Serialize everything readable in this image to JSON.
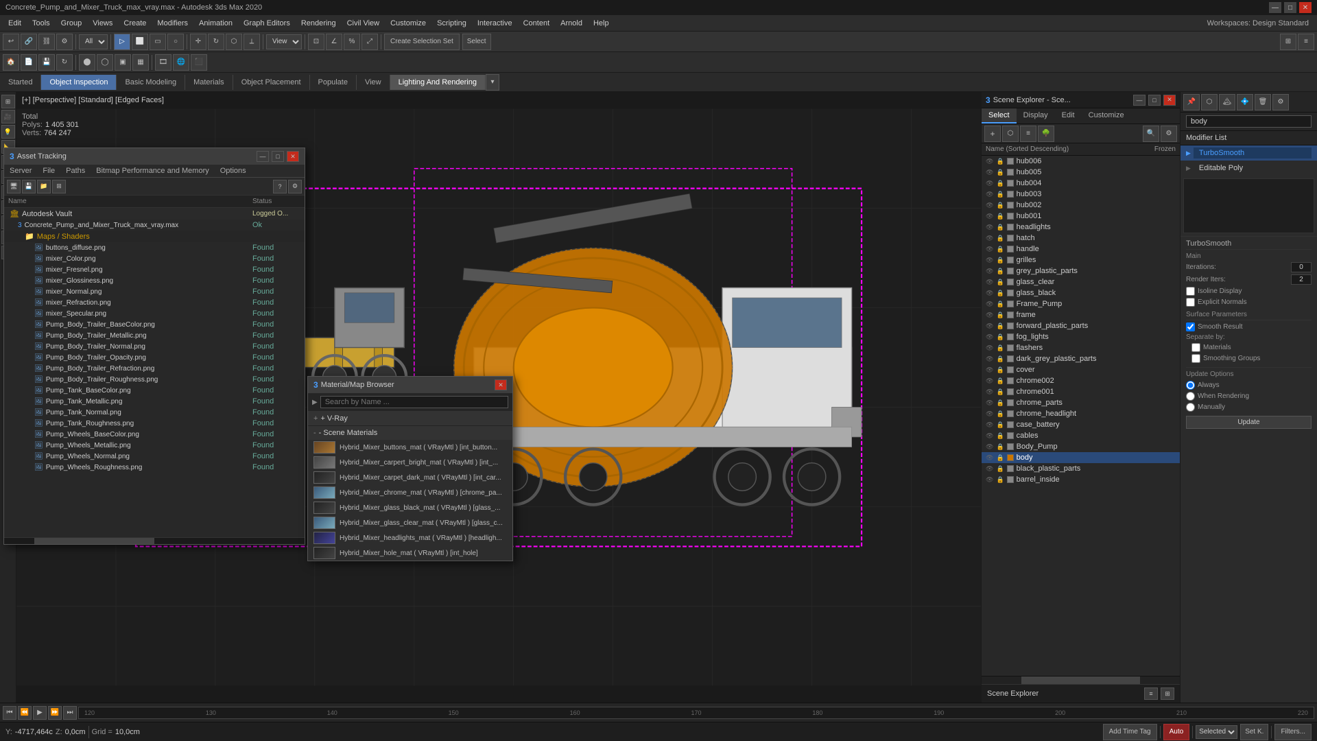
{
  "titlebar": {
    "title": "Concrete_Pump_and_Mixer_Truck_max_vray.max - Autodesk 3ds Max 2020",
    "min": "—",
    "max": "□",
    "close": "✕"
  },
  "menubar": {
    "items": [
      "Edit",
      "Tools",
      "Group",
      "Views",
      "Create",
      "Modifiers",
      "Animation",
      "Graph Editors",
      "Rendering",
      "Civil View",
      "Customize",
      "Scripting",
      "Interactive",
      "Content",
      "Arnold",
      "Help"
    ]
  },
  "toolbar": {
    "select_all_label": "All",
    "view_label": "View"
  },
  "tabs": {
    "items": [
      "Started",
      "Object Inspection",
      "Basic Modeling",
      "Materials",
      "Object Placement",
      "Populate",
      "View",
      "Lighting And Rendering"
    ]
  },
  "viewport": {
    "label": "[+] [Perspective] [Standard] [Edged Faces]",
    "stats": {
      "total_label": "Total",
      "polys_label": "Polys:",
      "polys_value": "1 405 301",
      "verts_label": "Verts:",
      "verts_value": "764 247"
    }
  },
  "scene_explorer": {
    "title": "Scene Explorer - Sce...",
    "tabs": [
      "Select",
      "Display",
      "Edit",
      "Customize"
    ],
    "header_name": "Name (Sorted Descending)",
    "header_frozen": "Frozen",
    "items": [
      {
        "name": "hub006"
      },
      {
        "name": "hub005"
      },
      {
        "name": "hub004"
      },
      {
        "name": "hub003"
      },
      {
        "name": "hub002"
      },
      {
        "name": "hub001"
      },
      {
        "name": "headlights"
      },
      {
        "name": "hatch"
      },
      {
        "name": "handle"
      },
      {
        "name": "grilles"
      },
      {
        "name": "grey_plastic_parts"
      },
      {
        "name": "glass_clear"
      },
      {
        "name": "glass_black"
      },
      {
        "name": "Frame_Pump"
      },
      {
        "name": "frame"
      },
      {
        "name": "forward_plastic_parts"
      },
      {
        "name": "fog_lights"
      },
      {
        "name": "flashers"
      },
      {
        "name": "dark_grey_plastic_parts"
      },
      {
        "name": "cover"
      },
      {
        "name": "chrome002"
      },
      {
        "name": "chrome001"
      },
      {
        "name": "chrome_parts"
      },
      {
        "name": "chrome_headlight"
      },
      {
        "name": "case_battery"
      },
      {
        "name": "cables"
      },
      {
        "name": "Body_Pump"
      },
      {
        "name": "body",
        "selected": true
      },
      {
        "name": "black_plastic_parts"
      },
      {
        "name": "barrel_inside"
      }
    ]
  },
  "properties_panel": {
    "modifier_list_label": "Modifier List",
    "body_label": "body",
    "modifiers": [
      {
        "name": "TurboSmooth",
        "type": "active"
      },
      {
        "name": "Editable Poly",
        "type": "sub"
      }
    ],
    "turbosmooth": {
      "title": "TurboSmooth",
      "main_label": "Main",
      "iterations_label": "Iterations:",
      "iterations_value": "0",
      "render_iters_label": "Render Iters:",
      "render_iters_value": "2",
      "isoline_display": "Isoline Display",
      "explicit_normals": "Explicit Normals",
      "surface_params_label": "Surface Parameters",
      "smooth_result": "Smooth Result",
      "separate_by_label": "Separate by:",
      "materials_label": "Materials",
      "smoothing_groups_label": "Smoothing Groups"
    },
    "update_options": {
      "title": "Update Options",
      "always": "Always",
      "when_rendering": "When Rendering",
      "manually": "Manually",
      "update_btn": "Update"
    },
    "scene_explorer_label": "Scene Explorer"
  },
  "asset_tracking": {
    "title": "Asset Tracking",
    "menus": [
      "Server",
      "File",
      "Paths",
      "Bitmap Performance and Memory",
      "Options"
    ],
    "columns": [
      "Name",
      "Status"
    ],
    "items": [
      {
        "type": "vault",
        "name": "Autodesk Vault",
        "status": "Logged O..."
      },
      {
        "type": "file",
        "name": "Concrete_Pump_and_Mixer_Truck_max_vray.max",
        "status": "Ok",
        "indent": 1
      },
      {
        "type": "group",
        "name": "Maps / Shaders",
        "indent": 2
      },
      {
        "type": "map",
        "name": "buttons_diffuse.png",
        "status": "Found",
        "indent": 3
      },
      {
        "type": "map",
        "name": "mixer_Color.png",
        "status": "Found",
        "indent": 3
      },
      {
        "type": "map",
        "name": "mixer_Fresnel.png",
        "status": "Found",
        "indent": 3
      },
      {
        "type": "map",
        "name": "mixer_Glossiness.png",
        "status": "Found",
        "indent": 3
      },
      {
        "type": "map",
        "name": "mixer_Normal.png",
        "status": "Found",
        "indent": 3
      },
      {
        "type": "map",
        "name": "mixer_Refraction.png",
        "status": "Found",
        "indent": 3
      },
      {
        "type": "map",
        "name": "mixer_Specular.png",
        "status": "Found",
        "indent": 3
      },
      {
        "type": "map",
        "name": "Pump_Body_Trailer_BaseColor.png",
        "status": "Found",
        "indent": 3
      },
      {
        "type": "map",
        "name": "Pump_Body_Trailer_Metallic.png",
        "status": "Found",
        "indent": 3
      },
      {
        "type": "map",
        "name": "Pump_Body_Trailer_Normal.png",
        "status": "Found",
        "indent": 3
      },
      {
        "type": "map",
        "name": "Pump_Body_Trailer_Opacity.png",
        "status": "Found",
        "indent": 3
      },
      {
        "type": "map",
        "name": "Pump_Body_Trailer_Refraction.png",
        "status": "Found",
        "indent": 3
      },
      {
        "type": "map",
        "name": "Pump_Body_Trailer_Roughness.png",
        "status": "Found",
        "indent": 3
      },
      {
        "type": "map",
        "name": "Pump_Tank_BaseColor.png",
        "status": "Found",
        "indent": 3
      },
      {
        "type": "map",
        "name": "Pump_Tank_Metallic.png",
        "status": "Found",
        "indent": 3
      },
      {
        "type": "map",
        "name": "Pump_Tank_Normal.png",
        "status": "Found",
        "indent": 3
      },
      {
        "type": "map",
        "name": "Pump_Tank_Roughness.png",
        "status": "Found",
        "indent": 3
      },
      {
        "type": "map",
        "name": "Pump_Wheels_BaseColor.png",
        "status": "Found",
        "indent": 3
      },
      {
        "type": "map",
        "name": "Pump_Wheels_Metallic.png",
        "status": "Found",
        "indent": 3
      },
      {
        "type": "map",
        "name": "Pump_Wheels_Normal.png",
        "status": "Found",
        "indent": 3
      },
      {
        "type": "map",
        "name": "Pump_Wheels_Roughness.png",
        "status": "Found",
        "indent": 3
      }
    ]
  },
  "material_browser": {
    "title": "Material/Map Browser",
    "search_placeholder": "Search by Name ...",
    "vray_section": "+ V-Ray",
    "scene_materials_section": "- Scene Materials",
    "materials": [
      {
        "name": "Hybrid_Mixer_buttons_mat  ( VRayMtl )  [int_button...",
        "thumb": "orange"
      },
      {
        "name": "Hybrid_Mixer_carpert_bright_mat  ( VRayMtl )  [int_...",
        "thumb": "grey"
      },
      {
        "name": "Hybrid_Mixer_carpet_dark_mat  ( VRayMtl )  [int_car...",
        "thumb": "dark"
      },
      {
        "name": "Hybrid_Mixer_chrome_mat  ( VRayMtl )  [chrome_pa...",
        "thumb": "glass"
      },
      {
        "name": "Hybrid_Mixer_glass_black_mat  ( VRayMtl )  [glass_...",
        "thumb": "dark"
      },
      {
        "name": "Hybrid_Mixer_glass_clear_mat  ( VRayMtl )  [glass_c...",
        "thumb": "glass"
      },
      {
        "name": "Hybrid_Mixer_headlights_mat  ( VRayMtl )  [headligh...",
        "thumb": "blue"
      },
      {
        "name": "Hybrid_Mixer_hole_mat  ( VRayMtl )  [int_hole]",
        "thumb": "dark"
      }
    ]
  },
  "timeline": {
    "ticks": [
      "120",
      "130",
      "140",
      "150",
      "160",
      "170",
      "180",
      "190",
      "200",
      "210",
      "220"
    ]
  },
  "statusbar": {
    "y_label": "Y:",
    "y_value": "-4717,464c",
    "z_label": "Z:",
    "z_value": "0,0cm",
    "grid_label": "Grid =",
    "grid_value": "10,0cm",
    "add_time_tag": "Add Time Tag",
    "auto_label": "Auto",
    "selected_label": "Selected",
    "set_k_label": "Set K.",
    "filters_label": "Filters..."
  },
  "workspace": {
    "label": "Workspaces: Design Standard"
  },
  "create_selection_set": "Create Selection Set",
  "select_btn": "Select"
}
